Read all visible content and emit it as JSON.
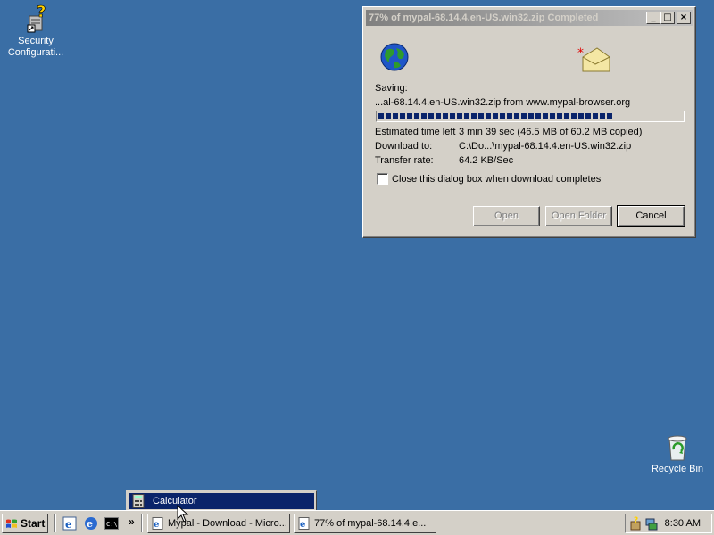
{
  "desktop": {
    "icons": [
      {
        "name": "Security Configurati...",
        "icon": "security-config-icon"
      },
      {
        "name": "Recycle Bin",
        "icon": "recycle-bin-icon"
      }
    ]
  },
  "dialog": {
    "title": "77% of mypal-68.14.4.en-US.win32.zip Completed",
    "saving_label": "Saving:",
    "saving_text": "...al-68.14.4.en-US.win32.zip from www.mypal-browser.org",
    "progress": 0.77,
    "time_left_label": "Estimated time left",
    "time_left_value": "3 min 39 sec (46.5 MB of 60.2 MB copied)",
    "download_to_label": "Download to:",
    "download_to_value": "C:\\Do...\\mypal-68.14.4.en-US.win32.zip",
    "transfer_rate_label": "Transfer rate:",
    "transfer_rate_value": "64.2 KB/Sec",
    "close_checkbox_label": "Close this dialog box when download completes",
    "close_checkbox_checked": false,
    "buttons": {
      "open": "Open",
      "open_folder": "Open Folder",
      "cancel": "Cancel"
    }
  },
  "popup_menu": {
    "items": [
      {
        "label": "Calculator",
        "icon": "calculator-icon",
        "highlighted": true
      }
    ]
  },
  "taskbar": {
    "start_label": "Start",
    "quick_launch": [
      "internet-explorer-icon",
      "mypal-browser-icon",
      "command-prompt-icon"
    ],
    "overflow_glyph": "»",
    "tasks": [
      {
        "label": "Mypal - Download - Micro...",
        "icon": "ie-page-icon"
      },
      {
        "label": "77% of mypal-68.14.4.e...",
        "icon": "ie-page-icon"
      }
    ],
    "clock": "8:30 AM"
  },
  "colors": {
    "desktop": "#3a6ea5",
    "highlight": "#0a246a",
    "window_face": "#d4d0c8"
  }
}
